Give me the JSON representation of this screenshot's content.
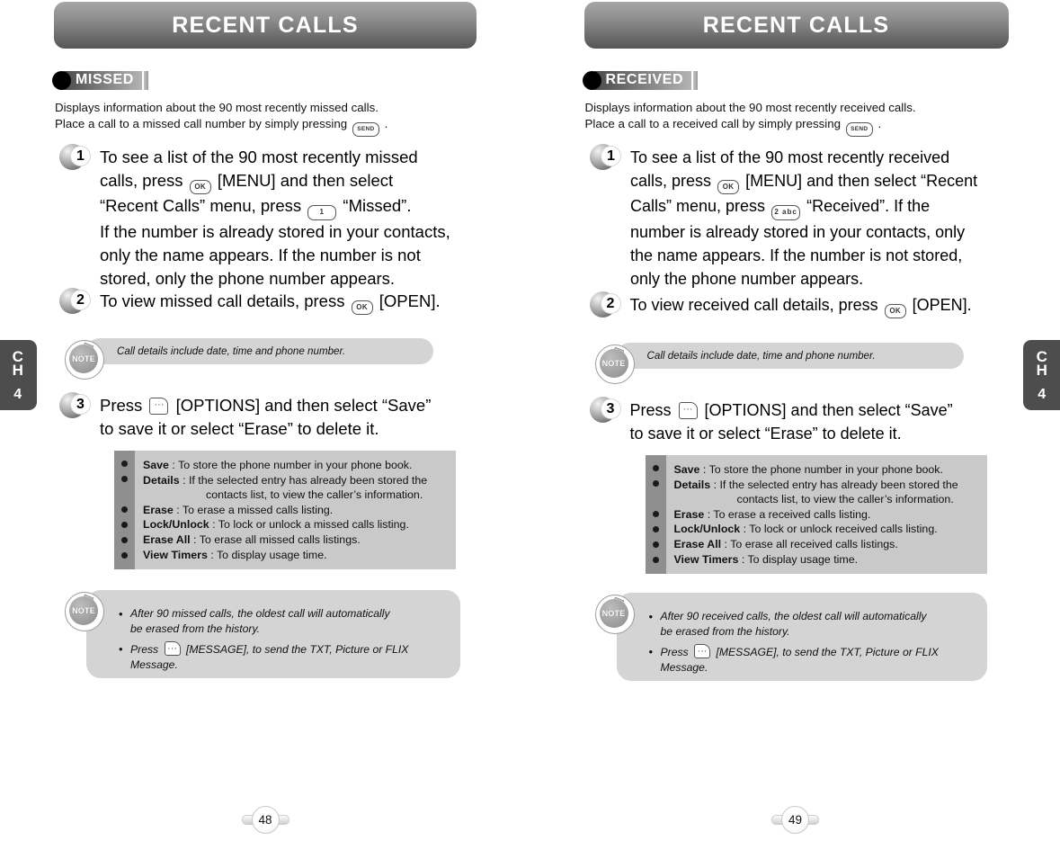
{
  "left_page": {
    "chapter": {
      "line1": "C",
      "line2": "H",
      "number": "4"
    },
    "banner_title": "RECENT CALLS",
    "section_tag": "MISSED",
    "intro_line1": "Displays information about the 90 most recently missed calls.",
    "intro_line2_a": "Place a call to a missed call number by simply pressing",
    "intro_line2_b": ".",
    "key_send": "SEND",
    "key_ok": "OK",
    "key_num": "1",
    "steps": [
      {
        "num": "1",
        "t1": "To see a list of the 90 most recently missed",
        "t2": "calls, press",
        "t3": "[MENU] and then select",
        "t4": "“Recent Calls” menu, press",
        "t5": "“Missed”.",
        "t6": "If the number is already stored in your contacts,",
        "t7": "only the name appears. If the number is not",
        "t8": "stored, only the phone number appears."
      },
      {
        "num": "2",
        "t1": "To view missed call details, press",
        "t2": "[OPEN]."
      },
      {
        "num": "3",
        "t1": "Press",
        "t2": "[OPTIONS] and then select “Save”",
        "t3": "to save it or select “Erase” to delete it."
      }
    ],
    "note_mid": "Call details include date, time and phone number.",
    "options": [
      {
        "label": "Save",
        "sep": " : ",
        "desc": "To store the phone number in your phone book.",
        "cont": ""
      },
      {
        "label": "Details",
        "sep": " : ",
        "desc": "If the selected entry has already been stored the",
        "cont": "contacts list, to view the caller’s information."
      },
      {
        "label": "Erase",
        "sep": " : ",
        "desc": "To erase a missed calls listing.",
        "cont": ""
      },
      {
        "label": "Lock/Unlock",
        "sep": " : ",
        "desc": "To lock or unlock a missed calls listing.",
        "cont": ""
      },
      {
        "label": "Erase All",
        "sep": " : ",
        "desc": "To erase all missed calls listings.",
        "cont": ""
      },
      {
        "label": "View Timers",
        "sep": " : ",
        "desc": "To display usage time.",
        "cont": ""
      }
    ],
    "note_bottom": {
      "b1_line1": "After 90 missed calls, the oldest call will automatically",
      "b1_line2": "be erased from the history.",
      "b2_a": "Press",
      "b2_b": "[MESSAGE], to send the TXT, Picture or FLIX",
      "b2_c": "Message."
    },
    "page_number": "48"
  },
  "right_page": {
    "chapter": {
      "line1": "C",
      "line2": "H",
      "number": "4"
    },
    "banner_title": "RECENT CALLS",
    "section_tag": "RECEIVED",
    "intro_line1": "Displays information about the 90 most recently received calls.",
    "intro_line2_a": "Place a call to a received call by simply pressing",
    "intro_line2_b": ".",
    "key_send": "SEND",
    "key_ok": "OK",
    "key_num": "2 abc",
    "steps": [
      {
        "num": "1",
        "t1": "To see a list of the 90 most recently received",
        "t2": "calls, press",
        "t3": "[MENU] and then select “Recent",
        "t4": "Calls” menu, press",
        "t5": "“Received”. If the",
        "t6": "number is already stored in your contacts, only",
        "t7": "the name appears. If the number is not stored,",
        "t8": "only the phone number appears."
      },
      {
        "num": "2",
        "t1": "To view received call details, press",
        "t2": "[OPEN]."
      },
      {
        "num": "3",
        "t1": "Press",
        "t2": "[OPTIONS] and then select “Save”",
        "t3": "to save it or select “Erase” to delete it."
      }
    ],
    "note_mid": "Call details include date, time and phone number.",
    "options": [
      {
        "label": "Save",
        "sep": " : ",
        "desc": "To store the phone number in your phone book.",
        "cont": ""
      },
      {
        "label": "Details",
        "sep": " : ",
        "desc": "If the selected entry has already been stored the",
        "cont": "contacts list, to view the caller’s information."
      },
      {
        "label": "Erase",
        "sep": " : ",
        "desc": "To erase a received calls listing.",
        "cont": ""
      },
      {
        "label": "Lock/Unlock",
        "sep": " : ",
        "desc": "To lock or unlock received calls listing.",
        "cont": ""
      },
      {
        "label": "Erase All",
        "sep": " : ",
        "desc": "To erase all received calls listings.",
        "cont": ""
      },
      {
        "label": "View Timers",
        "sep": " : ",
        "desc": "To display usage time.",
        "cont": ""
      }
    ],
    "note_bottom": {
      "b1_line1": "After 90 received calls, the oldest call will automatically",
      "b1_line2": "be erased from the history.",
      "b2_a": "Press",
      "b2_b": "[MESSAGE], to send the TXT, Picture or FLIX",
      "b2_c": "Message."
    },
    "page_number": "49"
  },
  "icons": {
    "note_badge_label": "NOTE"
  }
}
